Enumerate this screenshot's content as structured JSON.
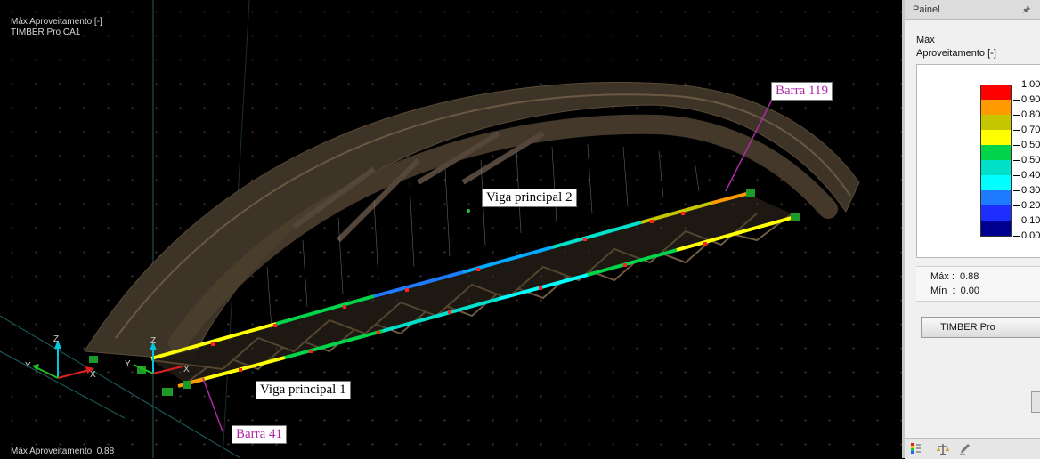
{
  "viewport": {
    "title_line1": "Máx Aproveitamento [-]",
    "title_line2": "TIMBER Pro CA1",
    "status": "Máx Aproveitamento: 0.88",
    "callouts": {
      "barra119": "Barra 119",
      "viga2": "Viga principal 2",
      "viga1": "Viga principal 1",
      "barra41": "Barra 41"
    },
    "axis_labels": {
      "z": "Z",
      "x": "X",
      "y": "Y"
    }
  },
  "panel": {
    "title": "Painel",
    "label_line1": "Máx",
    "label_line2": "Aproveitamento [-]",
    "scale": [
      {
        "value": "1.00",
        "color": "#ff0000"
      },
      {
        "value": "0.90",
        "color": "#ff9a00"
      },
      {
        "value": "0.80",
        "color": "#c6c600"
      },
      {
        "value": "0.70",
        "color": "#ffff00"
      },
      {
        "value": "0.50",
        "color": "#00d44a"
      },
      {
        "value": "0.50",
        "color": "#00e0c8"
      },
      {
        "value": "0.40",
        "color": "#00ffff"
      },
      {
        "value": "0.30",
        "color": "#1e7bff"
      },
      {
        "value": "0.20",
        "color": "#1e2eff"
      },
      {
        "value": "0.10",
        "color": "#000090"
      },
      {
        "value": "0.00",
        "color": ""
      }
    ],
    "max_text": "Máx :  0.88",
    "min_text": "Mín  :  0.00",
    "button_label": "TIMBER Pro"
  },
  "icons": [
    "pin-icon",
    "color-scale-icon",
    "scale-balance-icon",
    "pen-icon",
    "camera-icon"
  ]
}
